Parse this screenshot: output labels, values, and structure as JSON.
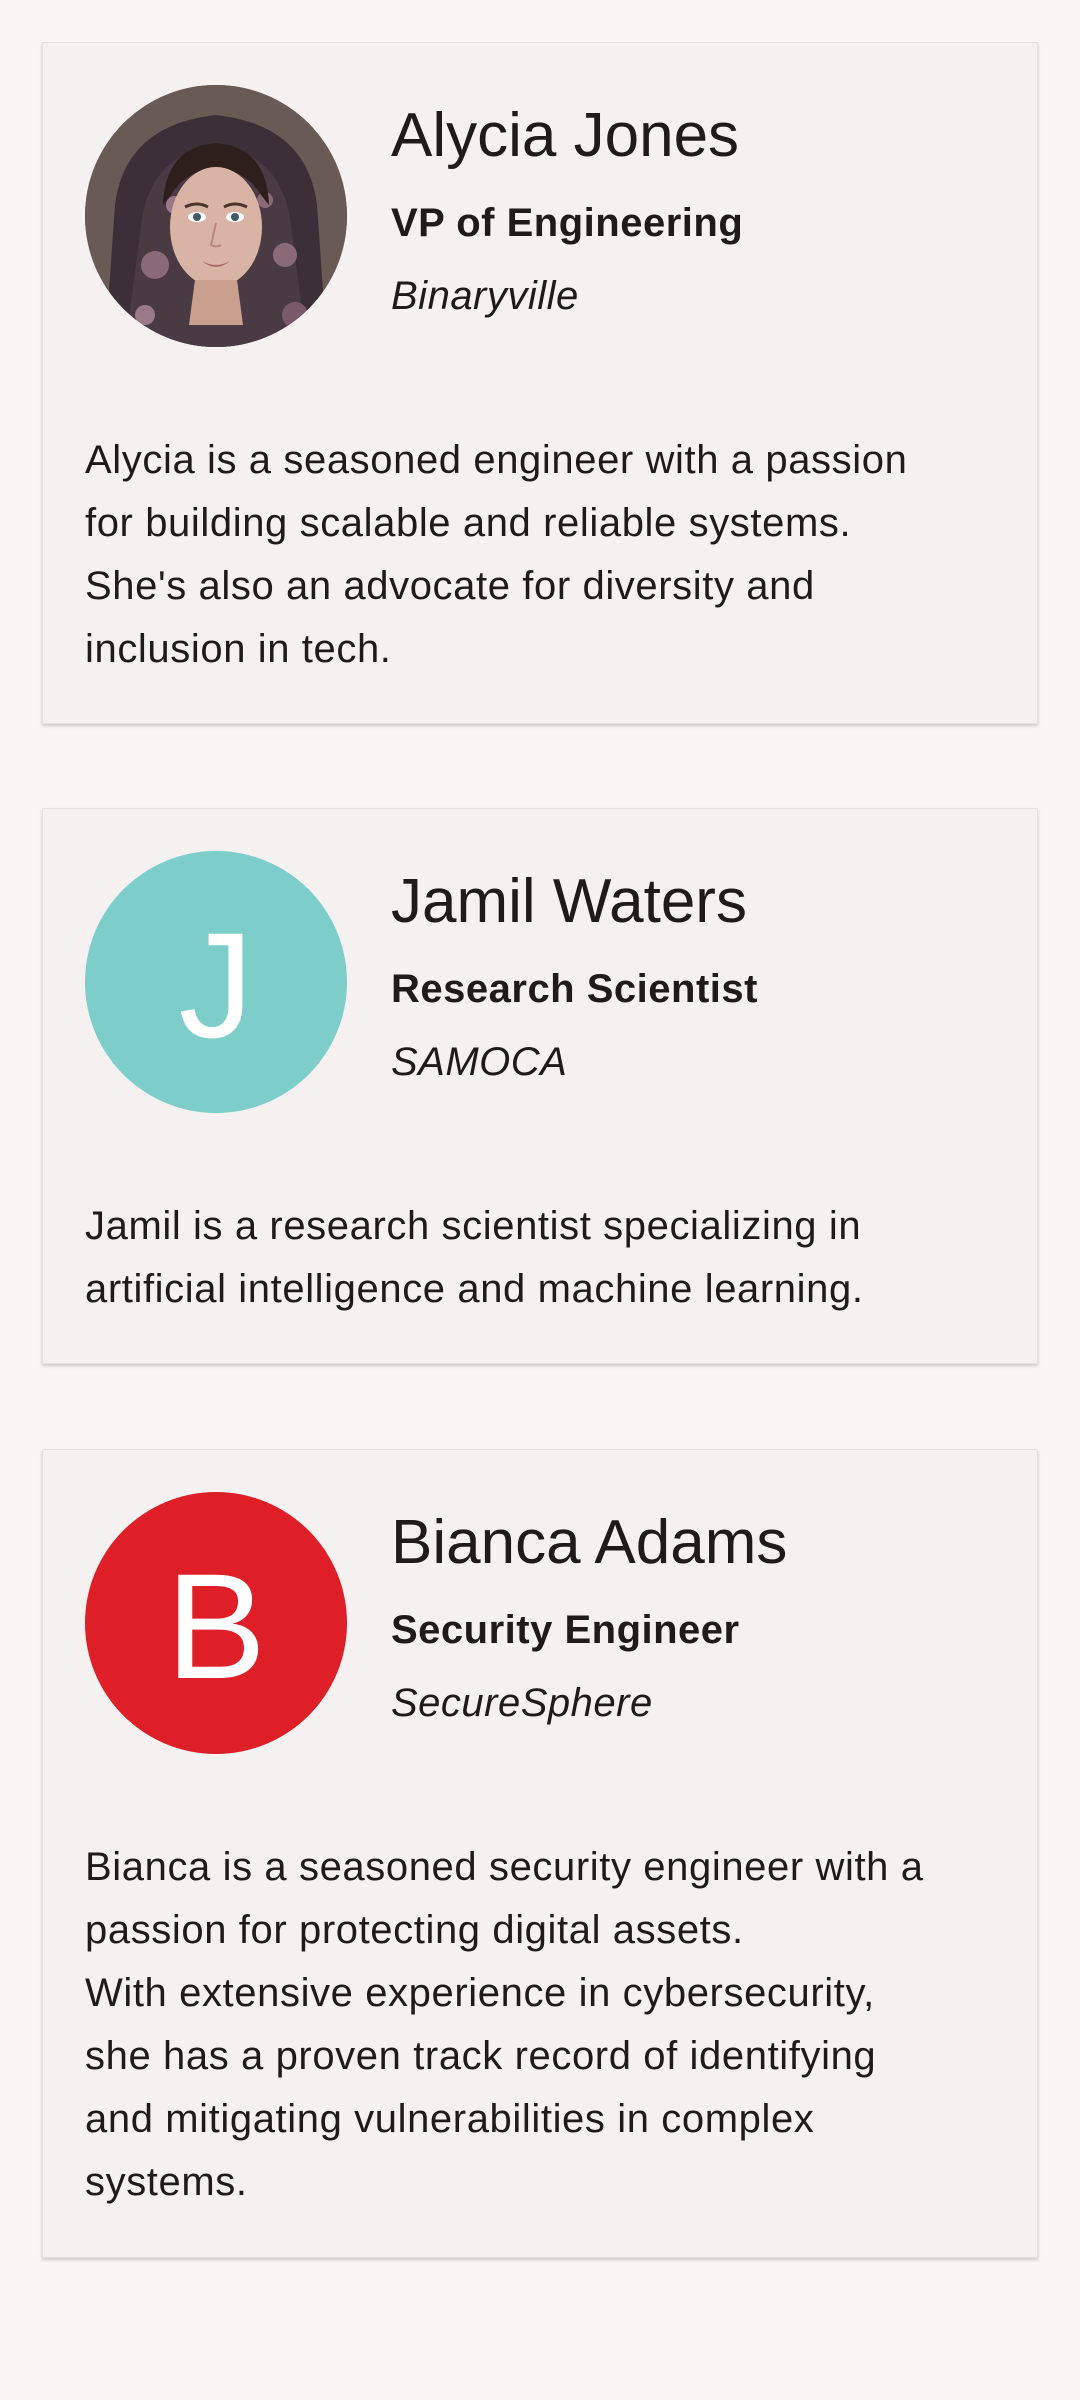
{
  "colors": {
    "background": "#f9f6f5",
    "card": "#f4f1f0",
    "avatar_teal": "#7dcdca",
    "avatar_red": "#de1f28"
  },
  "cards": [
    {
      "name": "Alycia Jones",
      "role": "VP of Engineering",
      "company": "Binaryville",
      "avatar_type": "photo",
      "bio": "Alycia is a seasoned engineer with a passion\nfor building scalable and reliable systems.\nShe's also an advocate for diversity and\ninclusion in tech."
    },
    {
      "name": "Jamil Waters",
      "role": "Research Scientist",
      "company": "SAMOCA",
      "avatar_type": "initial",
      "avatar_letter": "J",
      "bio": "Jamil is a research scientist specializing in\nartificial intelligence and machine learning."
    },
    {
      "name": "Bianca Adams",
      "role": "Security Engineer",
      "company": "SecureSphere",
      "avatar_type": "initial",
      "avatar_letter": "B",
      "bio": "Bianca is a seasoned security engineer with a\npassion for protecting digital assets.\nWith extensive experience in cybersecurity,\nshe has a proven track record of identifying\nand mitigating vulnerabilities in complex\nsystems."
    }
  ]
}
